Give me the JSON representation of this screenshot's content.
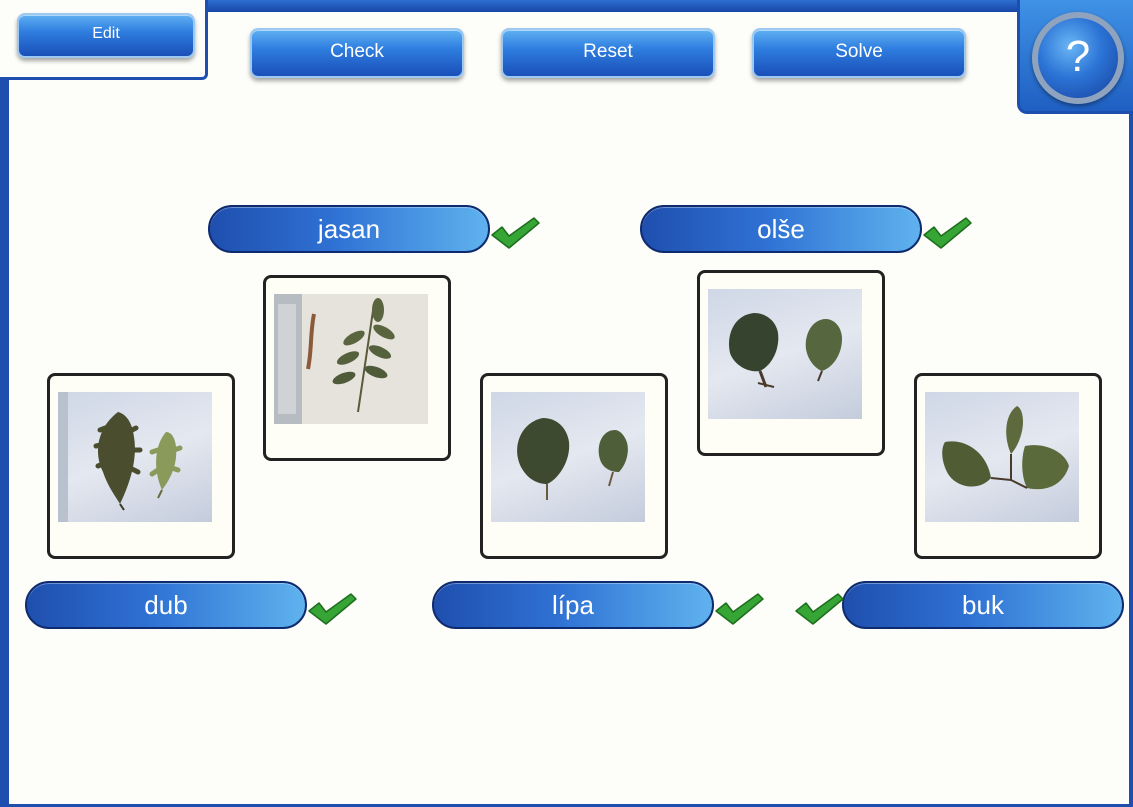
{
  "toolbar": {
    "edit_label": "Edit",
    "check_label": "Check",
    "reset_label": "Reset",
    "solve_label": "Solve",
    "help_label": "?"
  },
  "labels": {
    "jasan": "jasan",
    "olse": "olše",
    "dub": "dub",
    "lipa": "lípa",
    "buk": "buk"
  },
  "cards": [
    {
      "icon": "oak-leaves-photo"
    },
    {
      "icon": "ash-leaf-photo"
    },
    {
      "icon": "linden-leaves-photo"
    },
    {
      "icon": "alder-leaves-photo"
    },
    {
      "icon": "beech-leaves-photo"
    }
  ],
  "status": {
    "correct_icon": "check-icon",
    "correct_color": "#2f9e2f"
  },
  "colors": {
    "frame": "#1f4fae",
    "button_top": "#5fb0f2",
    "button_bottom": "#1a4fb8",
    "canvas": "#fdfdf9"
  }
}
